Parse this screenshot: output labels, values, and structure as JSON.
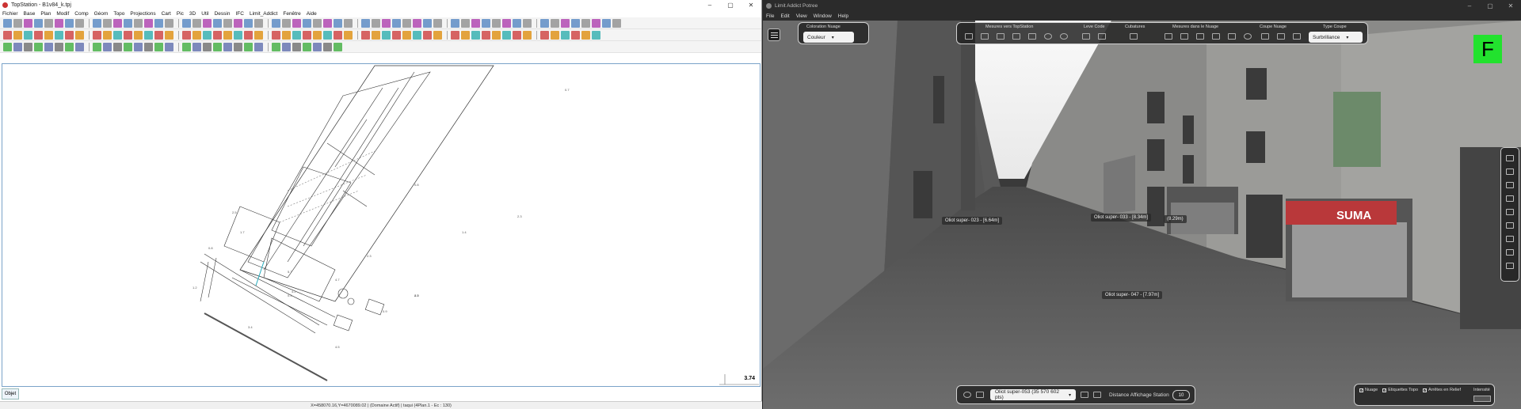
{
  "left": {
    "title": "TopStation - B1v84_k.tpj",
    "menu": [
      "Fichier",
      "Base",
      "Plan",
      "Modif",
      "Comp",
      "Géom",
      "Topo",
      "Projections",
      "Cart",
      "Pic",
      "3D",
      "Util",
      "Dessin",
      "IFC",
      "Limit_Addict",
      "Fenêtre",
      "Aide"
    ],
    "drawing_labels": [
      "0.7",
      "1.4",
      "2.3",
      "0.8",
      "1.7",
      "2.5",
      "0.8",
      "1.2",
      "4.7",
      "2.3",
      "2.5",
      "0.4",
      "4.5",
      "4.2",
      "4.2",
      "0.9",
      "3.4",
      "5.7"
    ],
    "scale_value": "3.74",
    "objet_label": "Objet",
    "status": "X=458070.16,Y=4670089.02 | (Domaine Actif) | taqui (4Plan.1 - Ec : 130)"
  },
  "right": {
    "title": "Limit Addict Potree",
    "menu": [
      "File",
      "Edit",
      "View",
      "Window",
      "Help"
    ],
    "coloration": {
      "label": "Coloration Nuage",
      "value": "Couleur"
    },
    "tool_groups": [
      "Mesures vers TopStation",
      "Leve Code",
      "Cubatures",
      "Mesures dans le Nuage",
      "Coupe Nuage"
    ],
    "type_coupe": {
      "label": "Type Coupe",
      "value": "Surbrillance"
    },
    "f_badge": "F",
    "points": [
      "Oliot super- 023 - [6.64m]",
      "Oliot super- 033 - [8.34m]",
      "(8.29m)",
      "Oliot super- 047 - [7.97m]"
    ],
    "shop_sign": "SUMA",
    "station": "Oliot super-053 (35 570 602 pts)",
    "distance_label": "Distance Affichage Station",
    "distance_value": "10",
    "checkboxes": [
      {
        "label": "Nuage",
        "checked": true
      },
      {
        "label": "Etiquettes Topo",
        "checked": true
      },
      {
        "label": "Arrêtes en Relief",
        "checked": true
      }
    ],
    "intensite_label": "Intensité"
  }
}
